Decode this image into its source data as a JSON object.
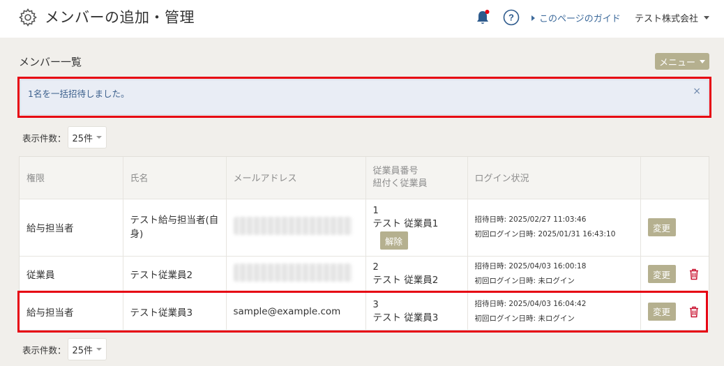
{
  "header": {
    "title": "メンバーの追加・管理",
    "guide_link": "このページのガイド",
    "company": "テスト株式会社"
  },
  "section": {
    "title": "メンバー一覧",
    "menu_label": "メニュー"
  },
  "alert": {
    "message": "1名を一括招待しました。",
    "close": "×"
  },
  "pagination": {
    "label": "表示件数：",
    "value": "25件"
  },
  "table": {
    "headers": {
      "role": "権限",
      "name": "氏名",
      "email": "メールアドレス",
      "employee_no": "従業員番号",
      "employee_link": "紐付く従業員",
      "login": "ログイン状況"
    },
    "rows": [
      {
        "role": "給与担当者",
        "name": "テスト給与担当者(自身)",
        "email": "",
        "employee_no": "1",
        "employee_name": "テスト 従業員1",
        "release_label": "解除",
        "invited": "招待日時: 2025/02/27 11:03:46",
        "first_login": "初回ログイン日時: 2025/01/31 16:43:10",
        "change_label": "変更"
      },
      {
        "role": "従業員",
        "name": "テスト従業員2",
        "email": "",
        "employee_no": "2",
        "employee_name": "テスト 従業員2",
        "invited": "招待日時: 2025/04/03 16:00:18",
        "first_login": "初回ログイン日時: 未ログイン",
        "change_label": "変更"
      },
      {
        "role": "給与担当者",
        "name": "テスト従業員3",
        "email": "sample@example.com",
        "employee_no": "3",
        "employee_name": "テスト 従業員3",
        "invited": "招待日時: 2025/04/03 16:04:42",
        "first_login": "初回ログイン日時: 未ログイン",
        "change_label": "変更"
      }
    ]
  },
  "colors": {
    "accent_button": "#b5b08f",
    "highlight_frame": "#e60012",
    "link": "#3d6a9b",
    "trash": "#c8102e",
    "bell": "#2d5a8c"
  }
}
